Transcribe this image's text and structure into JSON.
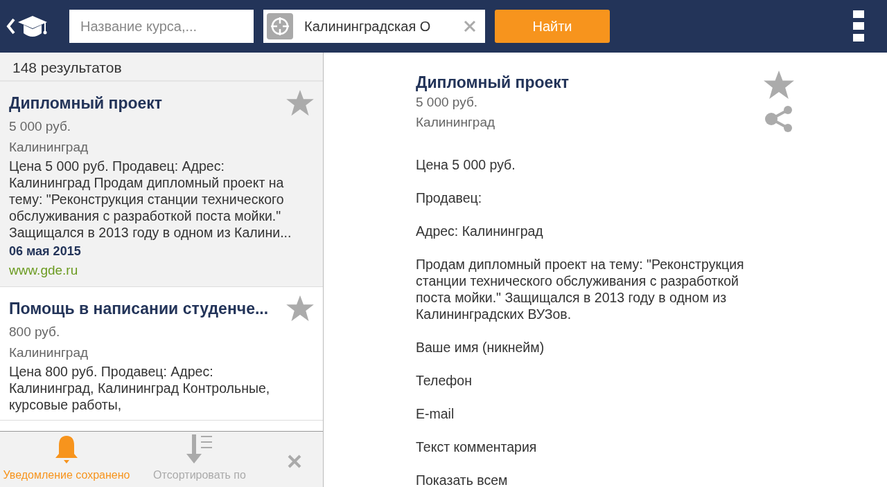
{
  "header": {
    "search": {
      "placeholder": "Название курса,..."
    },
    "location": {
      "value": "Калининградская О"
    },
    "search_button": "Найти"
  },
  "results": {
    "count": "148 результатов",
    "items": [
      {
        "title": "Дипломный проект",
        "price": "5 000 руб.",
        "city": "Калининград",
        "description": "Цена 5 000 руб. Продавец: Адрес: Калининград Продам дипломный проект на тему: \"Реконструкция станции технического обслуживания с разработкой поста мойки.\" Защищался в 2013 году в одном из Калини...",
        "date": "06 мая 2015",
        "source": "www.gde.ru",
        "selected": true
      },
      {
        "title": "Помощь в написании студенче...",
        "price": "800 руб.",
        "city": "Калининград",
        "description": "Цена 800 руб. Продавец: Адрес: Калининград, Калининград Контрольные, курсовые работы,",
        "selected": false
      }
    ]
  },
  "bottom_bar": [
    {
      "kind": "bell",
      "label": "Уведомление сохранено",
      "active": true
    },
    {
      "kind": "sort",
      "label": "Отсортировать по",
      "active": false
    },
    {
      "kind": "close"
    }
  ],
  "detail": {
    "title": "Дипломный проект",
    "price": "5 000 руб.",
    "city": "Калининград",
    "paragraphs": [
      "Цена 5 000 руб.",
      "Продавец:",
      "Адрес: Калининград",
      "Продам дипломный проект на тему: \"Реконструкция станции технического обслуживания с разработкой поста мойки.\" Защищался в 2013 году в одном из Калининградских ВУЗов.",
      "Ваше имя (никнейм)",
      "Телефон",
      "E-mail",
      "Текст комментария",
      "Показать всем"
    ]
  }
}
